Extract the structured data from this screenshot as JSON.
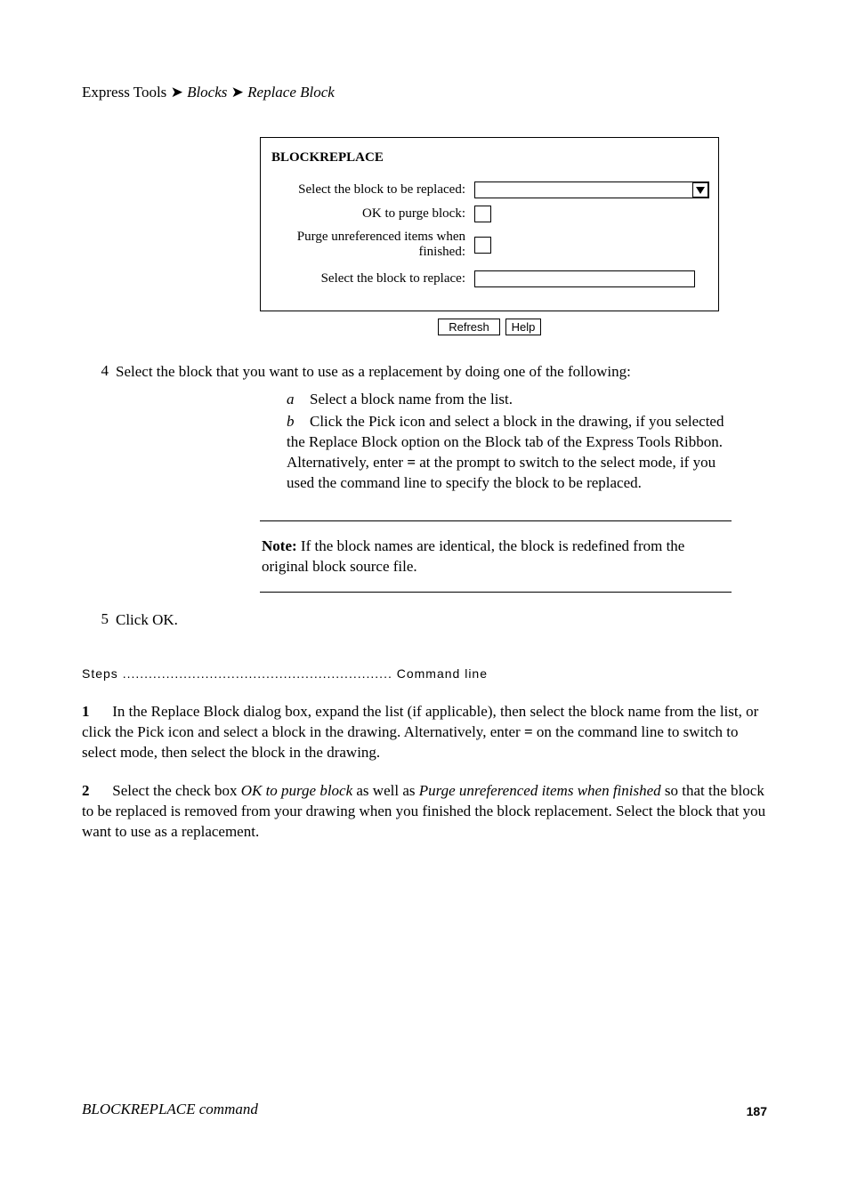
{
  "path": {
    "prefix": "Express Tools ",
    "arrow": "➤",
    "seg1": " Blocks ",
    "seg2": " Replace Block"
  },
  "form": {
    "title": "BLOCKREPLACE",
    "row1_label": "Select the block to be replaced:",
    "row2_label": "OK to purge block:",
    "row3_label": "Purge unreferenced items when finished:",
    "row4_label": "Select the block to replace:",
    "buttons": {
      "refresh": "Refresh",
      "help": "Help"
    }
  },
  "steps_mid": {
    "four": "4",
    "four_text": "Select the block that you want to use as a replacement by doing one of the following:",
    "bullet_a": "Select a block name from the list.",
    "bullet_b_prefix": "Click the Pick icon and select a block in the drawing, if you selected the Replace Block option on the Block tab of the Express Tools Ribbon. Alternatively, enter ",
    "bullet_b_code": "=",
    "bullet_b_suffix": " at the prompt to switch to the select mode, if you used the command line to specify the block to be replaced."
  },
  "note": {
    "label": "Note:",
    "text": " If the block names are identical, the block is redefined from the original block source file."
  },
  "paragraphs": {
    "five_num": "5",
    "five_text": "Click OK."
  },
  "steps_header": "Steps .............................................................. Command line",
  "p1": {
    "num": "1",
    "prefix": "In the Replace Block dialog box, expand the list (if applicable), then select the block name from the list, or click the Pick icon and select a block in the drawing. Alternatively, enter ",
    "code": "=",
    "suffix": " on the command line to switch to select mode, then select the block in the drawing."
  },
  "p2": {
    "num": "2",
    "prefix_a": "Select the check box ",
    "italic_a": "OK to purge block",
    "mid": " as well as ",
    "italic_b": "Purge unreferenced items when finished",
    "suffix": " so that the block to be replaced is removed from your drawing when you finished the block replacement. Select the block that you want to use as a replacement."
  },
  "footer": {
    "title": "BLOCKREPLACE command",
    "page": "187"
  }
}
